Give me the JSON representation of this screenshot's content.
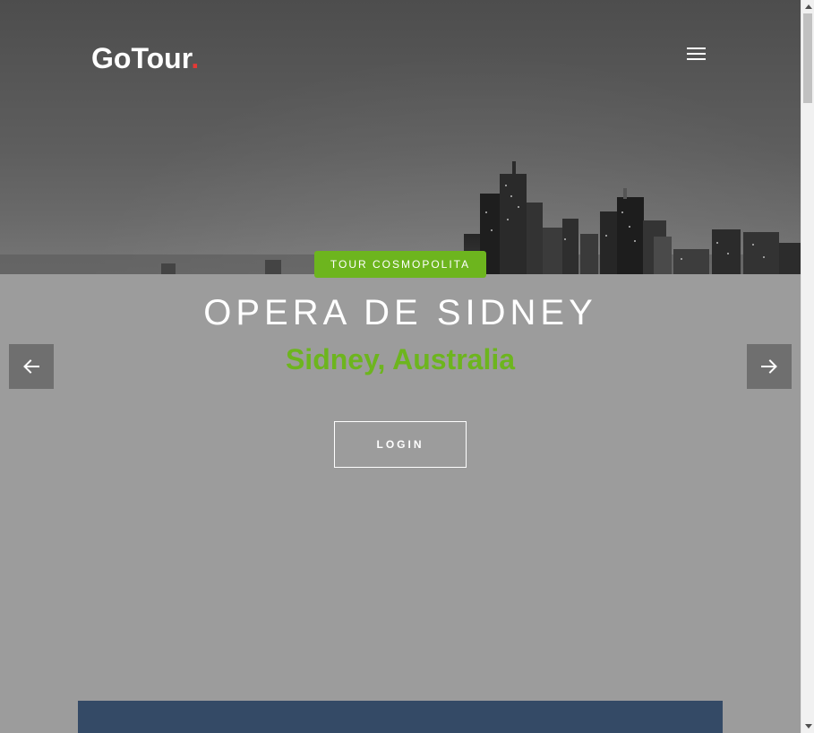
{
  "header": {
    "logo_text": "GoTour",
    "logo_dot": ".",
    "menu_icon": "hamburger-icon"
  },
  "slide": {
    "tag": "TOUR COSMOPOLITA",
    "title": "OPERA DE SIDNEY",
    "subtitle": "Sidney, Australia",
    "cta_label": "LOGIN"
  },
  "carousel": {
    "prev_icon": "arrow-left-icon",
    "next_icon": "arrow-right-icon"
  },
  "colors": {
    "accent": "#6db51e",
    "logo_dot": "#e53935",
    "overlay": "#9c9c9c",
    "panel": "#344a66",
    "arrow_bg": "#6f6f6f"
  }
}
